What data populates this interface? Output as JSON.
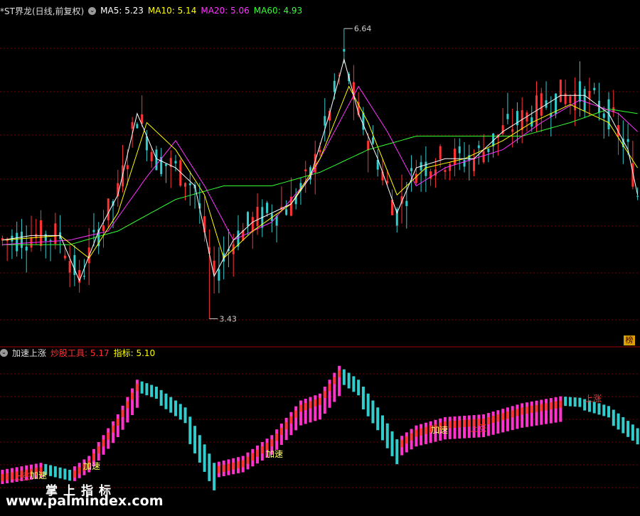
{
  "header_top": {
    "title": "*ST界龙(日线,前复权)",
    "indicators": [
      {
        "label": "MA5: 5.23",
        "color": "#ffffff"
      },
      {
        "label": "MA10: 5.14",
        "color": "#ffff00"
      },
      {
        "label": "MA20: 5.06",
        "color": "#ff33ff"
      },
      {
        "label": "MA60: 4.93",
        "color": "#33ff33"
      }
    ]
  },
  "header_bottom": {
    "title": "加速上涨",
    "items": [
      {
        "label": "炒股工具: 5.17",
        "color": "#ff3333"
      },
      {
        "label": "指标: 5.10",
        "color": "#ffff00"
      }
    ]
  },
  "annotations": {
    "high": "6.64",
    "low": "3.43",
    "flag": "榜"
  },
  "lower_labels": [
    {
      "text": "上涨",
      "color": "#ff3333"
    },
    {
      "text": "加速",
      "color": "#ffff66"
    },
    {
      "text": "加速",
      "color": "#ffff66"
    },
    {
      "text": "加速",
      "color": "#ffff66"
    },
    {
      "text": "加速",
      "color": "#ffff66"
    },
    {
      "text": "上涨",
      "color": "#ff3333"
    },
    {
      "text": "上涨",
      "color": "#ff3333"
    }
  ],
  "watermark": {
    "line1": "掌上指标",
    "line2": "www.palmindex.com"
  },
  "colors": {
    "up": "#ff3333",
    "down": "#33cccc",
    "ma5": "#ffffff",
    "ma10": "#ffff00",
    "ma20": "#ff33ff",
    "ma60": "#33ff33",
    "grid": "#7a0000"
  },
  "chart_data": {
    "type": "line",
    "price_range": [
      3.43,
      6.64
    ],
    "ma5_keypoints": [
      [
        0,
        4.3
      ],
      [
        6,
        4.35
      ],
      [
        12,
        4.35
      ],
      [
        16,
        3.85
      ],
      [
        20,
        4.4
      ],
      [
        24,
        4.8
      ],
      [
        28,
        5.7
      ],
      [
        32,
        5.2
      ],
      [
        36,
        5.1
      ],
      [
        40,
        4.9
      ],
      [
        44,
        3.9
      ],
      [
        48,
        4.3
      ],
      [
        52,
        4.5
      ],
      [
        56,
        4.6
      ],
      [
        60,
        4.7
      ],
      [
        64,
        5.0
      ],
      [
        68,
        5.7
      ],
      [
        71,
        6.3
      ],
      [
        74,
        5.7
      ],
      [
        78,
        5.2
      ],
      [
        82,
        4.6
      ],
      [
        86,
        5.1
      ],
      [
        92,
        5.2
      ],
      [
        98,
        5.2
      ],
      [
        104,
        5.5
      ],
      [
        110,
        5.7
      ],
      [
        116,
        5.9
      ],
      [
        121,
        5.9
      ],
      [
        126,
        5.7
      ],
      [
        130,
        5.3
      ],
      [
        132,
        4.8
      ]
    ],
    "ma10_keypoints": [
      [
        0,
        4.3
      ],
      [
        12,
        4.35
      ],
      [
        18,
        4.1
      ],
      [
        24,
        4.6
      ],
      [
        30,
        5.6
      ],
      [
        36,
        5.3
      ],
      [
        42,
        4.8
      ],
      [
        46,
        4.1
      ],
      [
        52,
        4.4
      ],
      [
        60,
        4.7
      ],
      [
        66,
        5.2
      ],
      [
        72,
        6.0
      ],
      [
        76,
        5.6
      ],
      [
        82,
        4.8
      ],
      [
        88,
        5.1
      ],
      [
        96,
        5.2
      ],
      [
        104,
        5.4
      ],
      [
        110,
        5.6
      ],
      [
        118,
        5.8
      ],
      [
        126,
        5.6
      ],
      [
        132,
        5.1
      ]
    ],
    "ma20_keypoints": [
      [
        0,
        4.25
      ],
      [
        14,
        4.3
      ],
      [
        22,
        4.4
      ],
      [
        30,
        5.0
      ],
      [
        36,
        5.4
      ],
      [
        42,
        4.9
      ],
      [
        48,
        4.3
      ],
      [
        56,
        4.5
      ],
      [
        64,
        5.0
      ],
      [
        70,
        5.6
      ],
      [
        74,
        6.0
      ],
      [
        80,
        5.5
      ],
      [
        86,
        4.9
      ],
      [
        92,
        5.1
      ],
      [
        104,
        5.3
      ],
      [
        112,
        5.6
      ],
      [
        120,
        5.85
      ],
      [
        128,
        5.7
      ],
      [
        132,
        5.5
      ]
    ],
    "ma60_keypoints": [
      [
        0,
        4.25
      ],
      [
        14,
        4.25
      ],
      [
        24,
        4.4
      ],
      [
        36,
        4.75
      ],
      [
        46,
        4.9
      ],
      [
        56,
        4.9
      ],
      [
        66,
        5.05
      ],
      [
        76,
        5.3
      ],
      [
        86,
        5.45
      ],
      [
        98,
        5.45
      ],
      [
        108,
        5.45
      ],
      [
        118,
        5.6
      ],
      [
        126,
        5.75
      ],
      [
        132,
        5.7
      ]
    ],
    "osc_keypoints": [
      [
        0,
        0.2
      ],
      [
        8,
        0.25
      ],
      [
        14,
        0.2
      ],
      [
        18,
        0.3
      ],
      [
        24,
        0.6
      ],
      [
        28,
        0.85
      ],
      [
        32,
        0.8
      ],
      [
        38,
        0.65
      ],
      [
        44,
        0.25
      ],
      [
        50,
        0.3
      ],
      [
        56,
        0.45
      ],
      [
        62,
        0.7
      ],
      [
        66,
        0.75
      ],
      [
        70,
        0.95
      ],
      [
        74,
        0.85
      ],
      [
        78,
        0.65
      ],
      [
        82,
        0.42
      ],
      [
        86,
        0.52
      ],
      [
        92,
        0.58
      ],
      [
        100,
        0.6
      ],
      [
        108,
        0.68
      ],
      [
        116,
        0.73
      ],
      [
        120,
        0.72
      ],
      [
        126,
        0.66
      ],
      [
        132,
        0.5
      ]
    ],
    "last_values": {
      "MA5": 5.23,
      "MA10": 5.14,
      "MA20": 5.06,
      "MA60": 4.93,
      "炒股工具": 5.17,
      "指标": 5.1
    }
  }
}
